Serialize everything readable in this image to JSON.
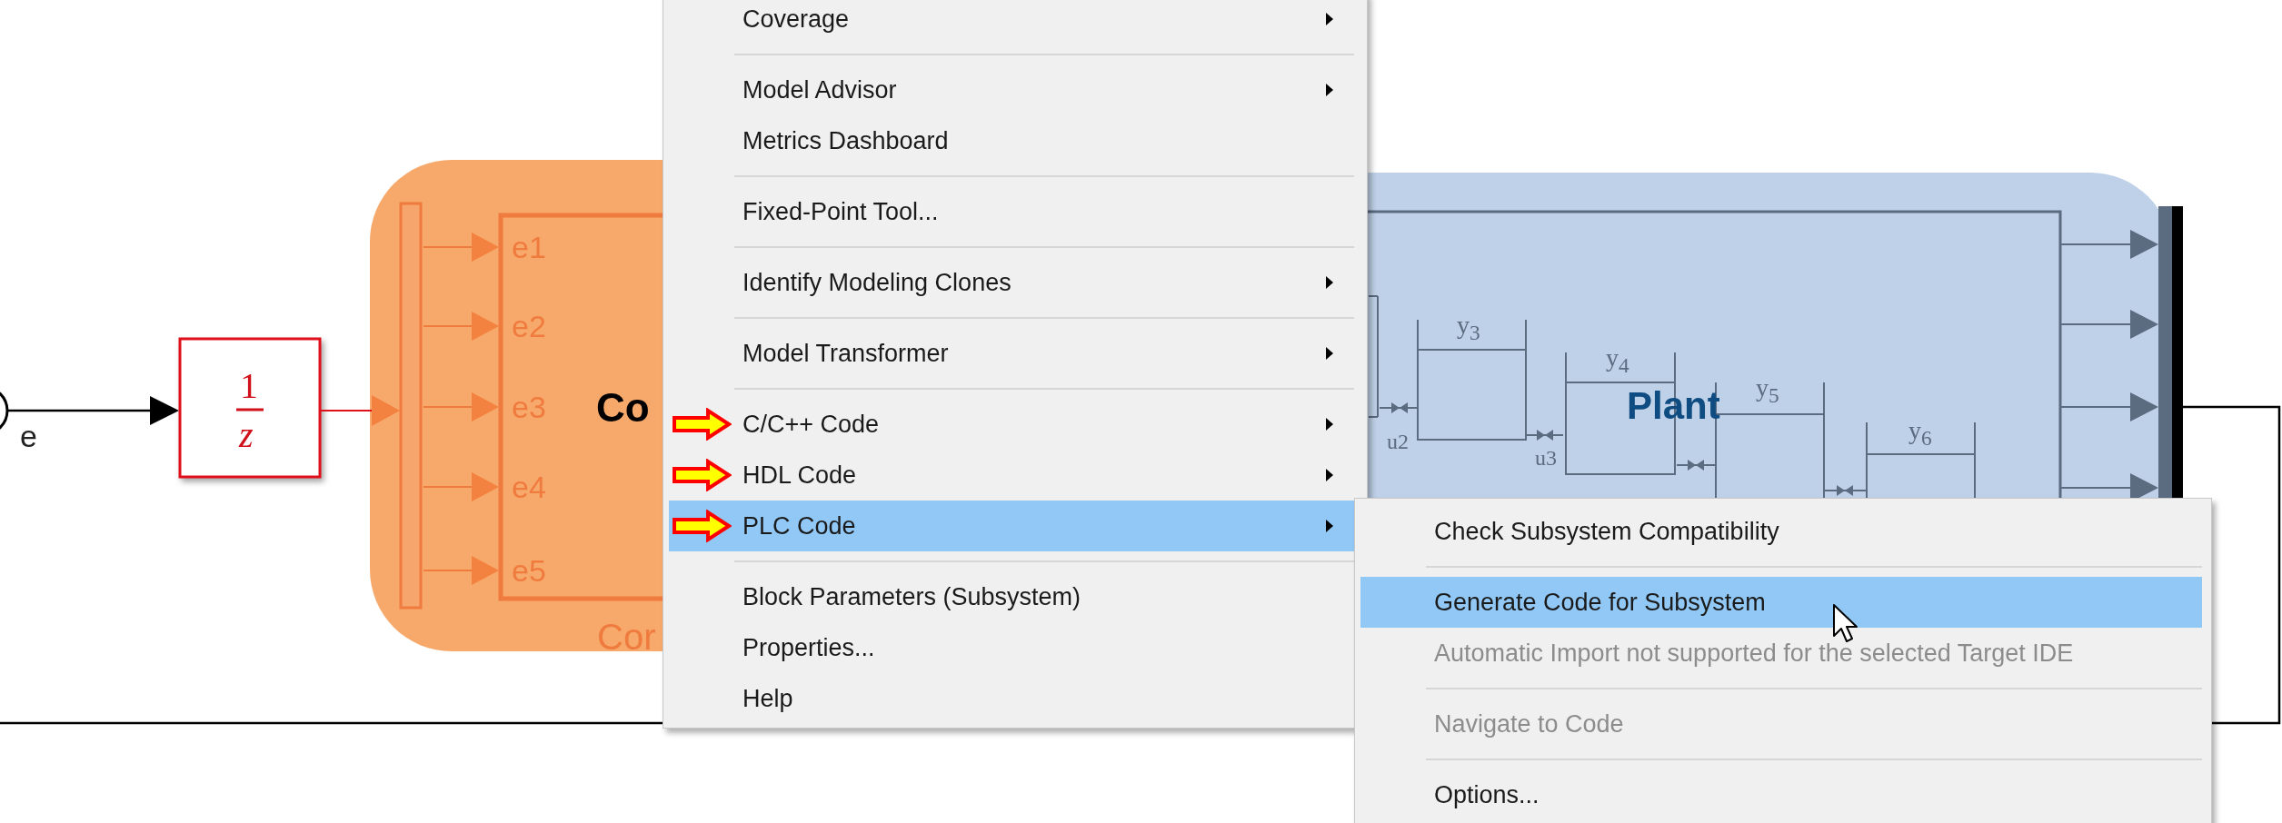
{
  "diagram": {
    "input_signal": {
      "label": "e"
    },
    "delay_block": {
      "numerator": "1",
      "denominator": "z"
    },
    "controller": {
      "title": "Co",
      "caption": "Cor",
      "ports": [
        "e1",
        "e2",
        "e3",
        "e4",
        "e5"
      ]
    },
    "plant": {
      "title": "Plant",
      "tanks": [
        "y$_{3}$",
        "y$_{4}$",
        "y$_{5}$",
        "y$_{6}$"
      ],
      "valves": [
        "u2",
        "u3"
      ]
    }
  },
  "context_menu": {
    "items": [
      {
        "kind": "command",
        "label": "Coverage",
        "has_submenu": true,
        "callout_arrow": false,
        "selected": false
      },
      {
        "kind": "separator"
      },
      {
        "kind": "command",
        "label": "Model Advisor",
        "has_submenu": true,
        "callout_arrow": false,
        "selected": false
      },
      {
        "kind": "command",
        "label": "Metrics Dashboard",
        "has_submenu": false,
        "callout_arrow": false,
        "selected": false
      },
      {
        "kind": "separator"
      },
      {
        "kind": "command",
        "label": "Fixed-Point Tool...",
        "has_submenu": false,
        "callout_arrow": false,
        "selected": false
      },
      {
        "kind": "separator"
      },
      {
        "kind": "command",
        "label": "Identify Modeling Clones",
        "has_submenu": true,
        "callout_arrow": false,
        "selected": false
      },
      {
        "kind": "separator"
      },
      {
        "kind": "command",
        "label": "Model Transformer",
        "has_submenu": true,
        "callout_arrow": false,
        "selected": false
      },
      {
        "kind": "separator"
      },
      {
        "kind": "command",
        "label": "C/C++ Code",
        "has_submenu": true,
        "callout_arrow": true,
        "selected": false
      },
      {
        "kind": "command",
        "label": "HDL Code",
        "has_submenu": true,
        "callout_arrow": true,
        "selected": false
      },
      {
        "kind": "command",
        "label": "PLC Code",
        "has_submenu": true,
        "callout_arrow": true,
        "selected": true
      },
      {
        "kind": "separator"
      },
      {
        "kind": "command",
        "label": "Block Parameters (Subsystem)",
        "has_submenu": false,
        "callout_arrow": false,
        "selected": false
      },
      {
        "kind": "command",
        "label": "Properties...",
        "has_submenu": false,
        "callout_arrow": false,
        "selected": false
      },
      {
        "kind": "command",
        "label": "Help",
        "has_submenu": false,
        "callout_arrow": false,
        "selected": false
      }
    ]
  },
  "submenu": {
    "items": [
      {
        "kind": "command",
        "label": "Check Subsystem Compatibility",
        "selected": false,
        "disabled": false
      },
      {
        "kind": "separator"
      },
      {
        "kind": "command",
        "label": "Generate Code for Subsystem",
        "selected": true,
        "disabled": false
      },
      {
        "kind": "command",
        "label": "Automatic Import not supported for the selected Target IDE",
        "selected": false,
        "disabled": true
      },
      {
        "kind": "separator"
      },
      {
        "kind": "command",
        "label": "Navigate to Code",
        "selected": false,
        "disabled": true
      },
      {
        "kind": "separator"
      },
      {
        "kind": "command",
        "label": "Options...",
        "selected": false,
        "disabled": false
      }
    ]
  }
}
